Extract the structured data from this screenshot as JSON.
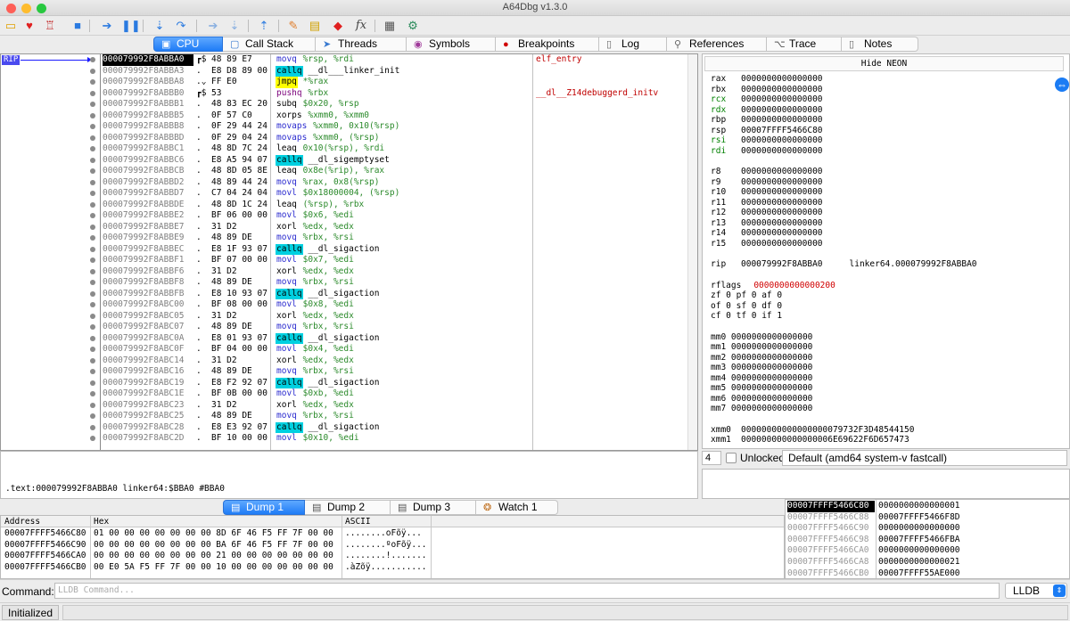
{
  "window": {
    "title": "A64Dbg v1.3.0"
  },
  "toolbar": {
    "icons": [
      "open-icon",
      "restart-icon",
      "close-debug-icon",
      "stop-icon",
      "run-icon",
      "pause-icon",
      "step-into-icon",
      "step-over-icon",
      "trace-into-icon",
      "trace-over-icon",
      "step-out-icon",
      "patch-icon",
      "comment-icon",
      "label-icon",
      "function-icon",
      "calculator-icon",
      "settings-icon"
    ]
  },
  "tabs": [
    {
      "label": "CPU",
      "icon": "cpu-icon"
    },
    {
      "label": "Call Stack",
      "icon": "window-icon"
    },
    {
      "label": "Threads",
      "icon": "threads-icon"
    },
    {
      "label": "Symbols",
      "icon": "symbols-icon"
    },
    {
      "label": "Breakpoints",
      "icon": "breakpoint-icon"
    },
    {
      "label": "Log",
      "icon": "log-icon"
    },
    {
      "label": "References",
      "icon": "search-icon"
    },
    {
      "label": "Trace",
      "icon": "trace-icon"
    },
    {
      "label": "Notes",
      "icon": "notes-icon"
    }
  ],
  "cpu": {
    "rip_label": "RIP",
    "rows": [
      {
        "addr": "000079992F8ABBA0",
        "gut": "┏$",
        "bytes": "48 89 E7",
        "mn": "movq",
        "op": "%rsp, %rdi",
        "cls": "m-mov",
        "hl": "",
        "cmt": "elf_entry",
        "cur": true
      },
      {
        "addr": "000079992F8ABBA3",
        "gut": ".",
        "bytes": "E8 D8 89 00",
        "mn": "callq",
        "op": "__dl___linker_init",
        "cls": "m-call",
        "hl": "call-hl",
        "cmt": ""
      },
      {
        "addr": "000079992F8ABBA8",
        "gut": ".⌄",
        "bytes": "FF E0",
        "mn": "jmpq",
        "op": "*%rax",
        "cls": "m-jmp",
        "hl": "jmp-hl",
        "cmt": ""
      },
      {
        "addr": "000079992F8ABBB0",
        "gut": "┏$",
        "bytes": "53",
        "mn": "pushq",
        "op": "%rbx",
        "cls": "m-push",
        "hl": "",
        "cmt": "__dl__Z14debuggerd_initv"
      },
      {
        "addr": "000079992F8ABBB1",
        "gut": ".",
        "bytes": "48 83 EC 20",
        "mn": "subq",
        "op": "$0x20, %rsp",
        "cls": "m-sub",
        "hl": "",
        "cmt": ""
      },
      {
        "addr": "000079992F8ABBB5",
        "gut": ".",
        "bytes": "0F 57 C0",
        "mn": "xorps",
        "op": "%xmm0, %xmm0",
        "cls": "m-xor",
        "hl": "",
        "cmt": ""
      },
      {
        "addr": "000079992F8ABBB8",
        "gut": ".",
        "bytes": "0F 29 44 24",
        "mn": "movaps",
        "op": "%xmm0, 0x10(%rsp)",
        "cls": "m-mov",
        "hl": "",
        "cmt": ""
      },
      {
        "addr": "000079992F8ABBBD",
        "gut": ".",
        "bytes": "0F 29 04 24",
        "mn": "movaps",
        "op": "%xmm0, (%rsp)",
        "cls": "m-mov",
        "hl": "",
        "cmt": ""
      },
      {
        "addr": "000079992F8ABBC1",
        "gut": ".",
        "bytes": "48 8D 7C 24",
        "mn": "leaq",
        "op": "0x10(%rsp), %rdi",
        "cls": "m-lea",
        "hl": "",
        "cmt": ""
      },
      {
        "addr": "000079992F8ABBC6",
        "gut": ".",
        "bytes": "E8 A5 94 07",
        "mn": "callq",
        "op": "__dl_sigemptyset",
        "cls": "m-call",
        "hl": "call-hl",
        "cmt": ""
      },
      {
        "addr": "000079992F8ABBCB",
        "gut": ".",
        "bytes": "48 8D 05 8E",
        "mn": "leaq",
        "op": "0x8e(%rip), %rax",
        "cls": "m-lea",
        "hl": "",
        "cmt": ""
      },
      {
        "addr": "000079992F8ABBD2",
        "gut": ".",
        "bytes": "48 89 44 24",
        "mn": "movq",
        "op": "%rax, 0x8(%rsp)",
        "cls": "m-mov",
        "hl": "",
        "cmt": ""
      },
      {
        "addr": "000079992F8ABBD7",
        "gut": ".",
        "bytes": "C7 04 24 04",
        "mn": "movl",
        "op": "$0x18000004, (%rsp)",
        "cls": "m-mov",
        "hl": "",
        "cmt": ""
      },
      {
        "addr": "000079992F8ABBDE",
        "gut": ".",
        "bytes": "48 8D 1C 24",
        "mn": "leaq",
        "op": "(%rsp), %rbx",
        "cls": "m-lea",
        "hl": "",
        "cmt": ""
      },
      {
        "addr": "000079992F8ABBE2",
        "gut": ".",
        "bytes": "BF 06 00 00",
        "mn": "movl",
        "op": "$0x6, %edi",
        "cls": "m-mov",
        "hl": "",
        "cmt": ""
      },
      {
        "addr": "000079992F8ABBE7",
        "gut": ".",
        "bytes": "31 D2",
        "mn": "xorl",
        "op": "%edx, %edx",
        "cls": "m-xor",
        "hl": "",
        "cmt": ""
      },
      {
        "addr": "000079992F8ABBE9",
        "gut": ".",
        "bytes": "48 89 DE",
        "mn": "movq",
        "op": "%rbx, %rsi",
        "cls": "m-mov",
        "hl": "",
        "cmt": ""
      },
      {
        "addr": "000079992F8ABBEC",
        "gut": ".",
        "bytes": "E8 1F 93 07",
        "mn": "callq",
        "op": "__dl_sigaction",
        "cls": "m-call",
        "hl": "call-hl",
        "cmt": ""
      },
      {
        "addr": "000079992F8ABBF1",
        "gut": ".",
        "bytes": "BF 07 00 00",
        "mn": "movl",
        "op": "$0x7, %edi",
        "cls": "m-mov",
        "hl": "",
        "cmt": ""
      },
      {
        "addr": "000079992F8ABBF6",
        "gut": ".",
        "bytes": "31 D2",
        "mn": "xorl",
        "op": "%edx, %edx",
        "cls": "m-xor",
        "hl": "",
        "cmt": ""
      },
      {
        "addr": "000079992F8ABBF8",
        "gut": ".",
        "bytes": "48 89 DE",
        "mn": "movq",
        "op": "%rbx, %rsi",
        "cls": "m-mov",
        "hl": "",
        "cmt": ""
      },
      {
        "addr": "000079992F8ABBFB",
        "gut": ".",
        "bytes": "E8 10 93 07",
        "mn": "callq",
        "op": "__dl_sigaction",
        "cls": "m-call",
        "hl": "call-hl",
        "cmt": ""
      },
      {
        "addr": "000079992F8ABC00",
        "gut": ".",
        "bytes": "BF 08 00 00",
        "mn": "movl",
        "op": "$0x8, %edi",
        "cls": "m-mov",
        "hl": "",
        "cmt": ""
      },
      {
        "addr": "000079992F8ABC05",
        "gut": ".",
        "bytes": "31 D2",
        "mn": "xorl",
        "op": "%edx, %edx",
        "cls": "m-xor",
        "hl": "",
        "cmt": ""
      },
      {
        "addr": "000079992F8ABC07",
        "gut": ".",
        "bytes": "48 89 DE",
        "mn": "movq",
        "op": "%rbx, %rsi",
        "cls": "m-mov",
        "hl": "",
        "cmt": ""
      },
      {
        "addr": "000079992F8ABC0A",
        "gut": ".",
        "bytes": "E8 01 93 07",
        "mn": "callq",
        "op": "__dl_sigaction",
        "cls": "m-call",
        "hl": "call-hl",
        "cmt": ""
      },
      {
        "addr": "000079992F8ABC0F",
        "gut": ".",
        "bytes": "BF 04 00 00",
        "mn": "movl",
        "op": "$0x4, %edi",
        "cls": "m-mov",
        "hl": "",
        "cmt": ""
      },
      {
        "addr": "000079992F8ABC14",
        "gut": ".",
        "bytes": "31 D2",
        "mn": "xorl",
        "op": "%edx, %edx",
        "cls": "m-xor",
        "hl": "",
        "cmt": ""
      },
      {
        "addr": "000079992F8ABC16",
        "gut": ".",
        "bytes": "48 89 DE",
        "mn": "movq",
        "op": "%rbx, %rsi",
        "cls": "m-mov",
        "hl": "",
        "cmt": ""
      },
      {
        "addr": "000079992F8ABC19",
        "gut": ".",
        "bytes": "E8 F2 92 07",
        "mn": "callq",
        "op": "__dl_sigaction",
        "cls": "m-call",
        "hl": "call-hl",
        "cmt": ""
      },
      {
        "addr": "000079992F8ABC1E",
        "gut": ".",
        "bytes": "BF 0B 00 00",
        "mn": "movl",
        "op": "$0xb, %edi",
        "cls": "m-mov",
        "hl": "",
        "cmt": ""
      },
      {
        "addr": "000079992F8ABC23",
        "gut": ".",
        "bytes": "31 D2",
        "mn": "xorl",
        "op": "%edx, %edx",
        "cls": "m-xor",
        "hl": "",
        "cmt": ""
      },
      {
        "addr": "000079992F8ABC25",
        "gut": ".",
        "bytes": "48 89 DE",
        "mn": "movq",
        "op": "%rbx, %rsi",
        "cls": "m-mov",
        "hl": "",
        "cmt": ""
      },
      {
        "addr": "000079992F8ABC28",
        "gut": ".",
        "bytes": "E8 E3 92 07",
        "mn": "callq",
        "op": "__dl_sigaction",
        "cls": "m-call",
        "hl": "call-hl",
        "cmt": ""
      },
      {
        "addr": "000079992F8ABC2D",
        "gut": ".",
        "bytes": "BF 10 00 00",
        "mn": "movl",
        "op": "$0x10, %edi",
        "cls": "m-mov",
        "hl": "",
        "cmt": ""
      }
    ]
  },
  "info": {
    "text": ".text:000079992F8ABBA0 linker64:$BBA0 #BBA0"
  },
  "registers": {
    "hide_neon": "Hide NEON",
    "gpr": [
      {
        "n": "rax",
        "v": "0000000000000000",
        "c": ""
      },
      {
        "n": "rbx",
        "v": "0000000000000000",
        "c": ""
      },
      {
        "n": "rcx",
        "v": "0000000000000000",
        "c": "grn"
      },
      {
        "n": "rdx",
        "v": "0000000000000000",
        "c": "grn"
      },
      {
        "n": "rbp",
        "v": "0000000000000000",
        "c": ""
      },
      {
        "n": "rsp",
        "v": "00007FFFF5466C80",
        "c": "red"
      },
      {
        "n": "rsi",
        "v": "0000000000000000",
        "c": "grn"
      },
      {
        "n": "rdi",
        "v": "0000000000000000",
        "c": "grn"
      }
    ],
    "gpr2": [
      {
        "n": "r8",
        "v": "0000000000000000"
      },
      {
        "n": "r9",
        "v": "0000000000000000"
      },
      {
        "n": "r10",
        "v": "0000000000000000"
      },
      {
        "n": "r11",
        "v": "0000000000000000"
      },
      {
        "n": "r12",
        "v": "0000000000000000"
      },
      {
        "n": "r13",
        "v": "0000000000000000"
      },
      {
        "n": "r14",
        "v": "0000000000000000"
      },
      {
        "n": "r15",
        "v": "0000000000000000"
      }
    ],
    "rip": {
      "n": "rip",
      "v": "000079992F8ABBA0",
      "sym": "linker64.000079992F8ABBA0"
    },
    "rflags": {
      "n": "rflags",
      "v": "0000000000000200"
    },
    "flags": [
      "zf 0  pf 0  af 0",
      "of 0  sf 0  df 0",
      "cf 0  tf 0  if 1"
    ],
    "mm": [
      "mm0 0000000000000000",
      "mm1 0000000000000000",
      "mm2 0000000000000000",
      "mm3 0000000000000000",
      "mm4 0000000000000000",
      "mm5 0000000000000000",
      "mm6 0000000000000000",
      "mm7 0000000000000000"
    ],
    "xmm": [
      {
        "n": "xmm0",
        "v": "00000000000000000079732F3D48544150"
      },
      {
        "n": "xmm1",
        "v": "000000000000000006E69622F6D657473"
      }
    ]
  },
  "callconv": {
    "count": "4",
    "unlocked_label": "Unlocked",
    "selected": "Default (amd64 system-v fastcall)"
  },
  "dump_tabs": [
    {
      "label": "Dump 1",
      "icon": "dump-icon"
    },
    {
      "label": "Dump 2",
      "icon": "dump-icon"
    },
    {
      "label": "Dump 3",
      "icon": "dump-icon"
    },
    {
      "label": "Watch 1",
      "icon": "watch-icon"
    }
  ],
  "dump": {
    "headers": {
      "address": "Address",
      "hex": "Hex",
      "ascii": "ASCII"
    },
    "rows": [
      {
        "a": "00007FFFF5466C80",
        "h": "01 00 00 00 00 00 00 00  8D 6F 46 F5 FF 7F 00 00",
        "s": "........oFõÿ..."
      },
      {
        "a": "00007FFFF5466C90",
        "h": "00 00 00 00 00 00 00 00  BA 6F 46 F5 FF 7F 00 00",
        "s": "........ºoFõÿ..."
      },
      {
        "a": "00007FFFF5466CA0",
        "h": "00 00 00 00 00 00 00 00  21 00 00 00 00 00 00 00",
        "s": "........!......."
      },
      {
        "a": "00007FFFF5466CB0",
        "h": "00 E0 5A F5 FF 7F 00 00  10 00 00 00 00 00 00 00",
        "s": ".àZõÿ..........."
      }
    ]
  },
  "stack": {
    "rows": [
      {
        "a": "00007FFFF5466C80",
        "v": "0000000000000001",
        "top": true
      },
      {
        "a": "00007FFFF5466C88",
        "v": "00007FFFF5466F8D"
      },
      {
        "a": "00007FFFF5466C90",
        "v": "0000000000000000"
      },
      {
        "a": "00007FFFF5466C98",
        "v": "00007FFFF5466FBA"
      },
      {
        "a": "00007FFFF5466CA0",
        "v": "0000000000000000"
      },
      {
        "a": "00007FFFF5466CA8",
        "v": "0000000000000021"
      },
      {
        "a": "00007FFFF5466CB0",
        "v": "00007FFFF55AE000"
      }
    ]
  },
  "command": {
    "label": "Command:",
    "placeholder": "LLDB Command...",
    "engine": "LLDB"
  },
  "status": {
    "text": "Initialized"
  }
}
